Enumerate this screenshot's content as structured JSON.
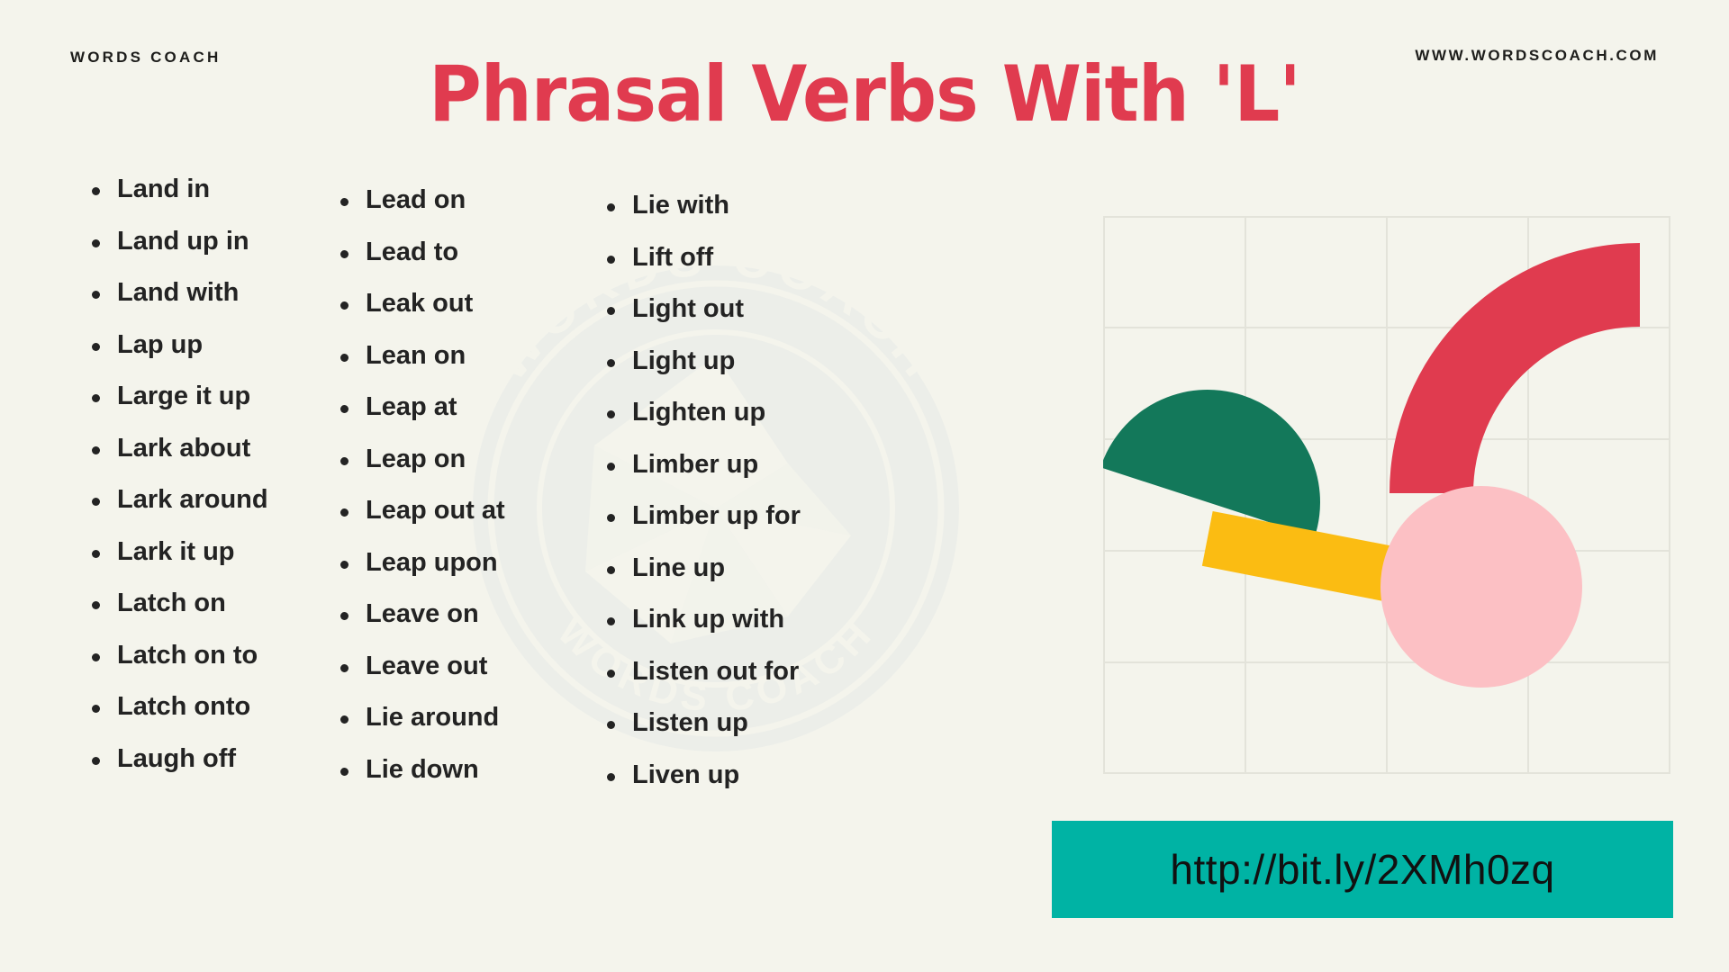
{
  "header": {
    "brand": "WORDS COACH",
    "site_url": "WWW.WORDSCOACH.COM",
    "title": "Phrasal Verbs With 'L'"
  },
  "watermark": {
    "text_top": "WORDS COACH",
    "text_bottom": "W O R D S   C O A C H"
  },
  "columns": [
    {
      "id": "column-1",
      "items": [
        "Land in",
        "Land up in",
        "Land with",
        "Lap up",
        "Large it up",
        "Lark about",
        "Lark around",
        "Lark it up",
        "Latch on",
        "Latch on to",
        "Latch onto",
        "Laugh off"
      ]
    },
    {
      "id": "column-2",
      "items": [
        "Lead on",
        "Lead to",
        "Leak out",
        "Lean on",
        "Leap at",
        "Leap on",
        "Leap out at",
        "Leap upon",
        "Leave on",
        "Leave out",
        "Lie around",
        "Lie down"
      ]
    },
    {
      "id": "column-3",
      "items": [
        "Lie with",
        "Lift off",
        "Light out",
        "Light up",
        "Lighten up",
        "Limber up",
        "Limber up for",
        "Line up",
        "Link up with",
        "Listen out for",
        "Listen up",
        "Liven up"
      ]
    }
  ],
  "banner": {
    "url": "http://bit.ly/2XMh0zq",
    "background_color": "#00B3A4"
  },
  "artwork": {
    "grid_color": "#E3E3DA",
    "shapes": [
      {
        "name": "green-half-circle",
        "color": "#13785A"
      },
      {
        "name": "red-quarter-arc",
        "color": "#E03B4F"
      },
      {
        "name": "yellow-bar",
        "color": "#FBBC12"
      },
      {
        "name": "pink-circle",
        "color": "#FCC0C4"
      }
    ]
  },
  "colors": {
    "background": "#F4F4EC",
    "accent_red": "#E03B4F",
    "accent_teal": "#00B3A4",
    "text_dark": "#232323"
  }
}
